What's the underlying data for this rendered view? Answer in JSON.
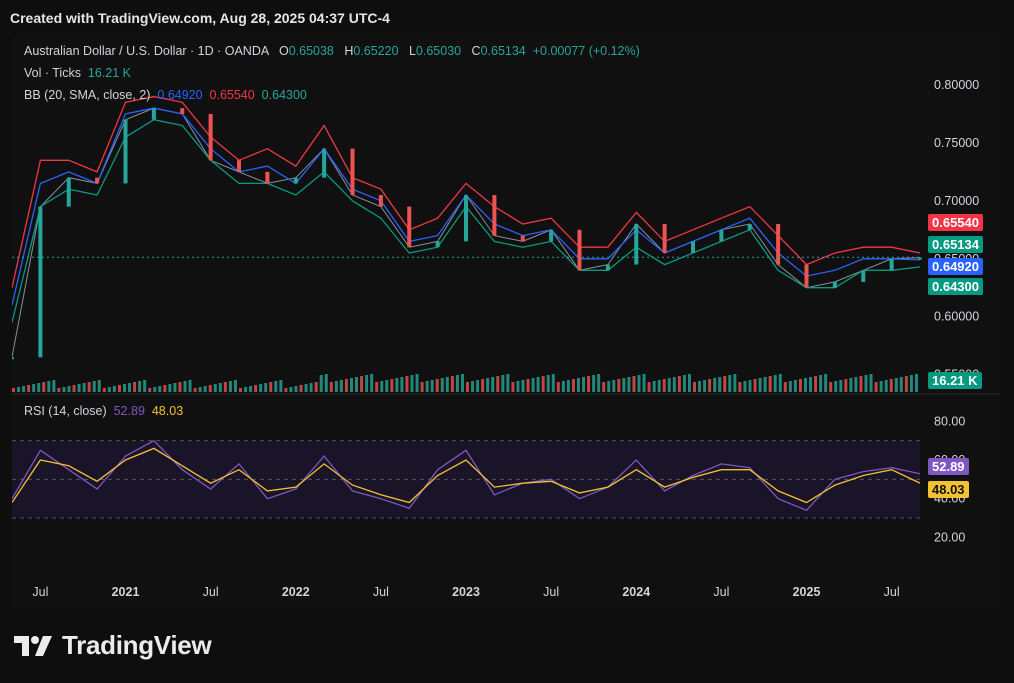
{
  "header": {
    "created_text": "Created with TradingView.com, Aug 28, 2025 04:37 UTC-4"
  },
  "legend": {
    "symbol": "Australian Dollar / U.S. Dollar · 1D · OANDA",
    "o_label": "O",
    "o_value": "0.65038",
    "h_label": "H",
    "h_value": "0.65220",
    "l_label": "L",
    "l_value": "0.65030",
    "c_label": "C",
    "c_value": "0.65134",
    "change": "+0.00077 (+0.12%)",
    "vol_label": "Vol · Ticks",
    "vol_value": "16.21 K",
    "bb_label": "BB (20, SMA, close, 2)",
    "bb_basis": "0.64920",
    "bb_upper": "0.65540",
    "bb_lower": "0.64300",
    "rsi_label": "RSI (14, close)",
    "rsi_value": "52.89",
    "rsi_ma": "48.03"
  },
  "tags": {
    "upper": "0.65540",
    "close": "0.65134",
    "basis": "0.64920",
    "lower": "0.64300",
    "volume": "16.21 K",
    "rsi": "52.89",
    "rsi_ma": "48.03"
  },
  "colors": {
    "up": "#26a69a",
    "down": "#ef5350",
    "bb_upper": "#f23645",
    "bb_basis": "#2962ff",
    "bb_lower": "#089981",
    "rsi": "#7e57c2",
    "rsi_ma": "#f2c230",
    "grid": "#1c1c1c"
  },
  "footer": {
    "brand": "TradingView",
    "logo_icon": "tradingview-logo-icon"
  },
  "chart_data": [
    {
      "type": "line",
      "title": "Australian Dollar / U.S. Dollar · 1D · OANDA",
      "x": [
        "2020-05",
        "2020-07",
        "2020-09",
        "2020-11",
        "2021-01",
        "2021-03",
        "2021-05",
        "2021-07",
        "2021-09",
        "2021-11",
        "2022-01",
        "2022-03",
        "2022-05",
        "2022-07",
        "2022-09",
        "2022-11",
        "2023-01",
        "2023-03",
        "2023-05",
        "2023-07",
        "2023-09",
        "2023-11",
        "2024-01",
        "2024-03",
        "2024-05",
        "2024-07",
        "2024-09",
        "2024-11",
        "2025-01",
        "2025-03",
        "2025-05",
        "2025-07",
        "2025-08"
      ],
      "x_tick_labels": [
        "Jul",
        "2021",
        "Jul",
        "2022",
        "Jul",
        "2023",
        "Jul",
        "2024",
        "Jul",
        "2025",
        "Jul"
      ],
      "y_tick_labels": [
        "0.80000",
        "0.75000",
        "0.70000",
        "0.65000",
        "0.60000",
        "0.55000"
      ],
      "ylim": [
        0.535,
        0.825
      ],
      "series": [
        {
          "name": "close",
          "values": [
            0.565,
            0.695,
            0.72,
            0.715,
            0.77,
            0.78,
            0.775,
            0.735,
            0.725,
            0.715,
            0.72,
            0.745,
            0.705,
            0.695,
            0.66,
            0.665,
            0.705,
            0.67,
            0.665,
            0.675,
            0.64,
            0.645,
            0.68,
            0.655,
            0.665,
            0.675,
            0.68,
            0.645,
            0.625,
            0.63,
            0.64,
            0.65,
            0.651
          ]
        },
        {
          "name": "BB upper",
          "values": [
            0.625,
            0.735,
            0.735,
            0.725,
            0.785,
            0.79,
            0.785,
            0.755,
            0.735,
            0.745,
            0.73,
            0.765,
            0.72,
            0.71,
            0.675,
            0.685,
            0.715,
            0.695,
            0.68,
            0.685,
            0.66,
            0.66,
            0.69,
            0.665,
            0.675,
            0.685,
            0.695,
            0.67,
            0.645,
            0.655,
            0.66,
            0.66,
            0.655
          ]
        },
        {
          "name": "BB basis",
          "values": [
            0.61,
            0.715,
            0.725,
            0.715,
            0.775,
            0.78,
            0.775,
            0.745,
            0.725,
            0.73,
            0.715,
            0.745,
            0.71,
            0.7,
            0.665,
            0.67,
            0.705,
            0.68,
            0.67,
            0.675,
            0.65,
            0.65,
            0.675,
            0.655,
            0.665,
            0.675,
            0.685,
            0.655,
            0.635,
            0.64,
            0.65,
            0.65,
            0.649
          ]
        },
        {
          "name": "BB lower",
          "values": [
            0.595,
            0.695,
            0.71,
            0.705,
            0.755,
            0.77,
            0.765,
            0.735,
            0.715,
            0.715,
            0.705,
            0.725,
            0.7,
            0.685,
            0.655,
            0.66,
            0.695,
            0.665,
            0.66,
            0.665,
            0.64,
            0.64,
            0.66,
            0.645,
            0.655,
            0.665,
            0.675,
            0.64,
            0.625,
            0.625,
            0.64,
            0.64,
            0.643
          ]
        }
      ]
    },
    {
      "type": "line",
      "title": "RSI (14, close)",
      "y_tick_labels": [
        "80.00",
        "60.00",
        "40.00",
        "20.00"
      ],
      "ylim": [
        0,
        90
      ],
      "bands": [
        30,
        50,
        70
      ],
      "series": [
        {
          "name": "RSI",
          "values": [
            40,
            65,
            55,
            45,
            62,
            70,
            55,
            45,
            58,
            40,
            45,
            62,
            44,
            40,
            35,
            55,
            65,
            42,
            48,
            50,
            40,
            46,
            60,
            44,
            52,
            58,
            56,
            40,
            34,
            50,
            54,
            56,
            52.89
          ]
        },
        {
          "name": "RSI MA",
          "values": [
            38,
            60,
            57,
            49,
            60,
            66,
            57,
            48,
            55,
            44,
            46,
            58,
            47,
            42,
            38,
            52,
            60,
            46,
            48,
            49,
            43,
            46,
            55,
            46,
            51,
            55,
            55,
            44,
            38,
            47,
            52,
            55,
            48.03
          ]
        }
      ]
    }
  ]
}
